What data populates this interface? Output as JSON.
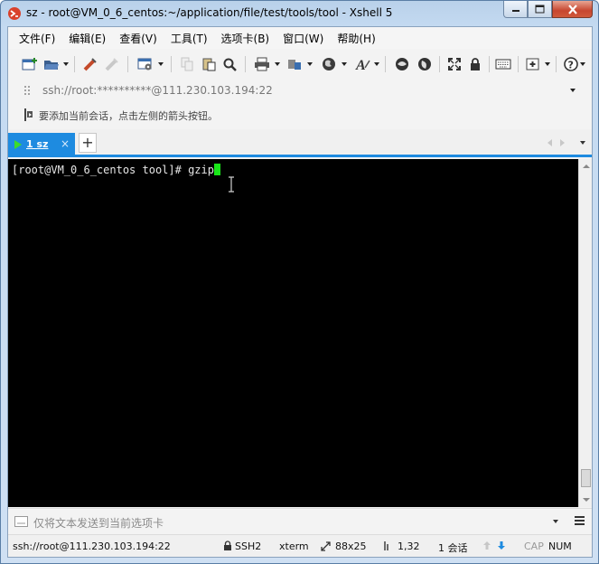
{
  "window": {
    "title": "sz - root@VM_0_6_centos:~/application/file/test/tools/tool - Xshell 5",
    "controls": [
      "minimize",
      "maximize",
      "close"
    ]
  },
  "menu": {
    "items": [
      "文件(F)",
      "编辑(E)",
      "查看(V)",
      "工具(T)",
      "选项卡(B)",
      "窗口(W)",
      "帮助(H)"
    ]
  },
  "toolbar": {
    "icons": [
      "new-session-icon",
      "open-folder-icon",
      "reconnect-icon",
      "disconnect-icon",
      "properties-icon",
      "copy-icon",
      "paste-icon",
      "find-icon",
      "print-icon",
      "transfer-icon",
      "globe-icon",
      "font-icon",
      "xftp-icon",
      "xmanager-icon",
      "fullscreen-icon",
      "lock-icon",
      "keyboard-icon",
      "add-icon",
      "help-icon"
    ]
  },
  "address": {
    "text": "ssh://root:**********@111.230.103.194:22"
  },
  "hint": {
    "text": "要添加当前会话，点击左侧的箭头按钮。"
  },
  "tabs": {
    "active_label": "1 sz",
    "close_glyph": "×",
    "add_glyph": "+"
  },
  "terminal": {
    "prompt": "[root@VM_0_6_centos tool]# gzip"
  },
  "sendbar": {
    "placeholder": "仅将文本发送到当前选项卡"
  },
  "status": {
    "connection": "ssh://root@111.230.103.194:22",
    "protocol": "SSH2",
    "terminal_type": "xterm",
    "size": "88x25",
    "cursor_position": "1,32",
    "sessions": "1 会话",
    "caps": "CAP",
    "num": "NUM"
  },
  "colors": {
    "accent": "#1e8be0",
    "terminal_bg": "#000000",
    "cursor": "#19e619"
  }
}
